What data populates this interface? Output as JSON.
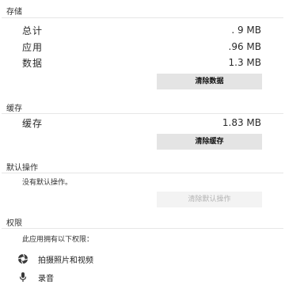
{
  "storage": {
    "title": "存储",
    "rows": [
      {
        "label": "总计",
        "value": ". 9 MB"
      },
      {
        "label": "应用",
        "value": ".96 MB"
      },
      {
        "label": "数据",
        "value": "1.3 MB"
      }
    ],
    "clear_data_button": "清除数据"
  },
  "cache": {
    "title": "缓存",
    "rows": [
      {
        "label": "缓存",
        "value": "1.83 MB"
      }
    ],
    "clear_cache_button": "清除缓存"
  },
  "defaults": {
    "title": "默认操作",
    "text": "没有默认操作。",
    "clear_defaults_button": "清除默认操作"
  },
  "permissions": {
    "title": "权限",
    "intro": "此应用拥有以下权限：",
    "items": [
      {
        "label": "拍摄照片和视频",
        "icon": "camera-icon"
      },
      {
        "label": "录音",
        "icon": "microphone-icon"
      }
    ]
  }
}
